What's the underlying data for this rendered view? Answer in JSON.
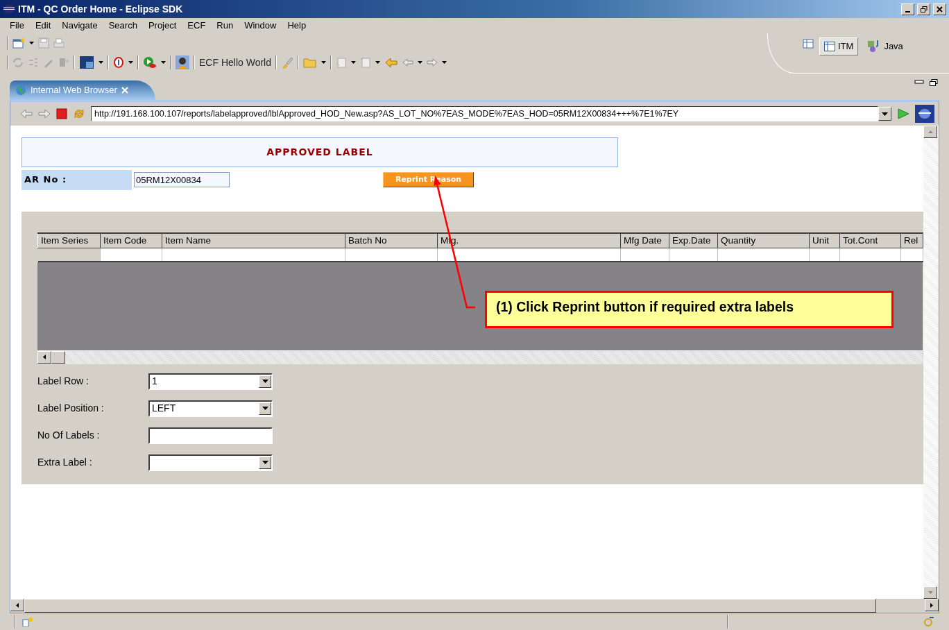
{
  "window": {
    "title": "ITM -  QC Order  Home - Eclipse SDK"
  },
  "menu": [
    "File",
    "Edit",
    "Navigate",
    "Search",
    "Project",
    "ECF",
    "Run",
    "Window",
    "Help"
  ],
  "toolbar": {
    "launch_label": "ECF Hello World"
  },
  "perspectives": [
    {
      "label": "ITM",
      "selected": true
    },
    {
      "label": "Java",
      "selected": false
    }
  ],
  "editor_tab": {
    "label": "Internal Web Browser"
  },
  "browser": {
    "url": "http://191.168.100.107/reports/labelapproved/lblApproved_HOD_New.asp?AS_LOT_NO%7EAS_MODE%7EAS_HOD=05RM12X00834+++%7E1%7EY"
  },
  "page": {
    "title": "APPROVED LABEL",
    "ar_label": "AR No :",
    "ar_value": "05RM12X00834",
    "reprint_button": "Reprint Reason",
    "table": {
      "columns": [
        "Item Series",
        "Item Code",
        "Item Name",
        "Batch No",
        "Mfg.",
        "Mfg Date",
        "Exp.Date",
        "Quantity",
        "Unit",
        "Tot.Cont",
        "Rel"
      ]
    },
    "form": [
      {
        "label": "Label Row :",
        "kind": "select",
        "value": "1"
      },
      {
        "label": "Label Position :",
        "kind": "select",
        "value": "LEFT"
      },
      {
        "label": "No Of Labels :",
        "kind": "text"
      },
      {
        "label": "Extra Label :",
        "kind": "select"
      }
    ]
  },
  "callout": {
    "text": "(1) Click Reprint button if required extra labels"
  }
}
